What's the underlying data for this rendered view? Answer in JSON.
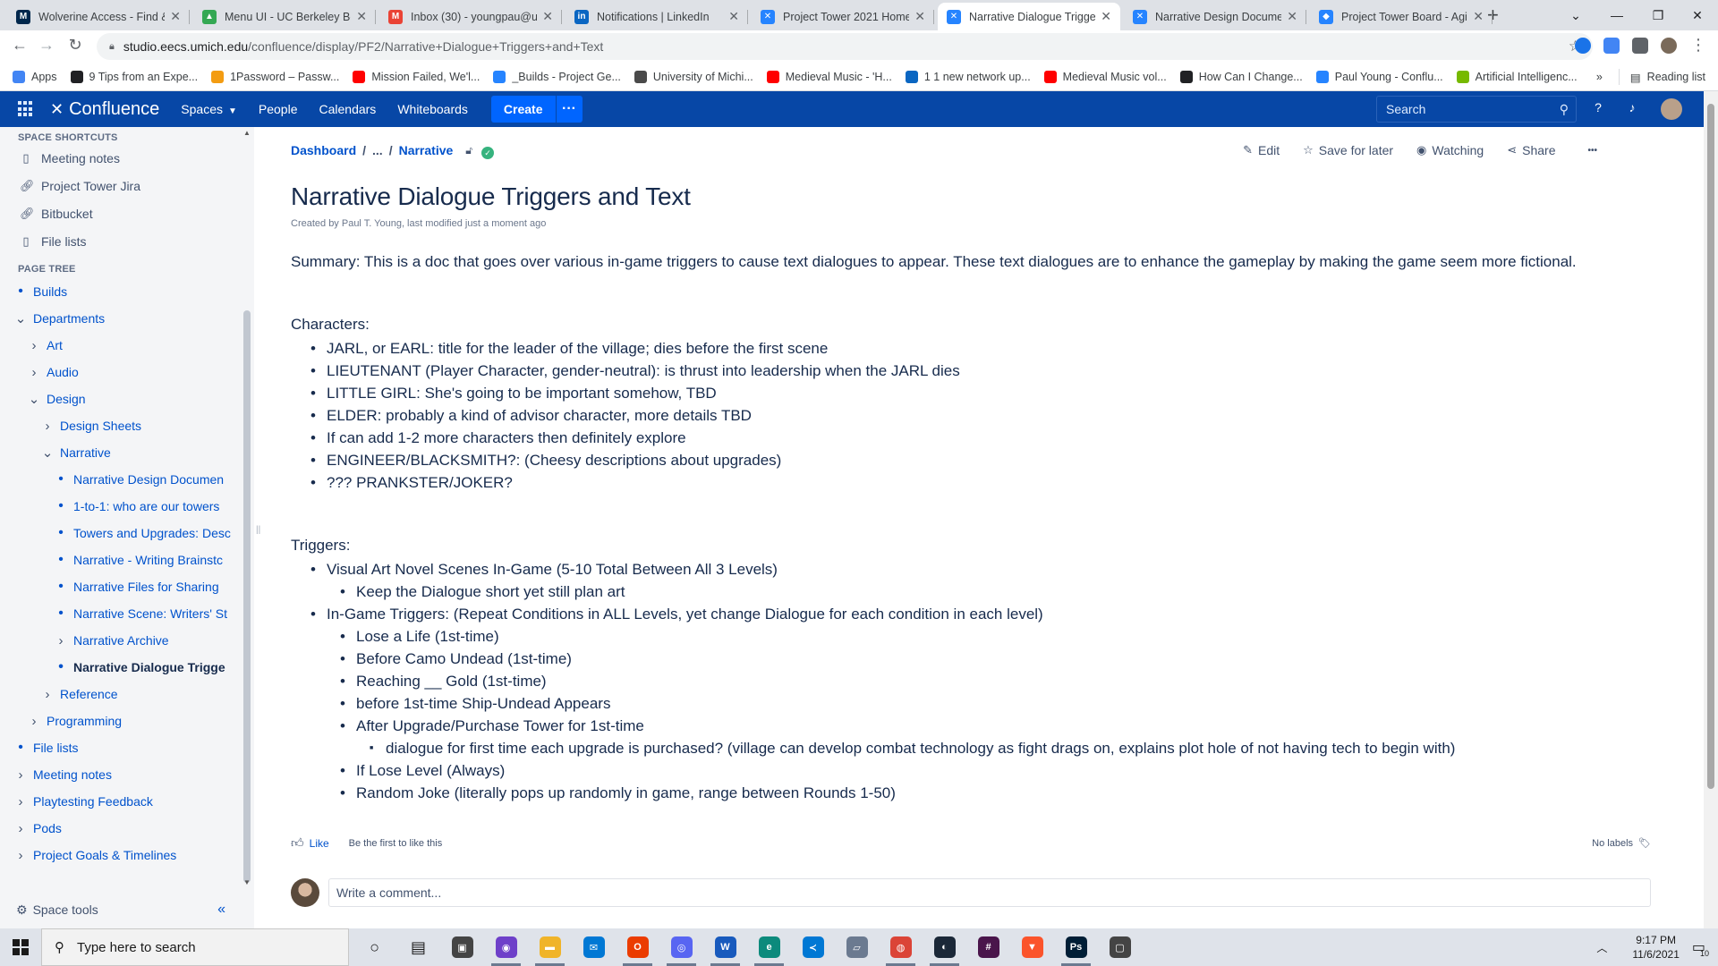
{
  "browser": {
    "tabs": [
      {
        "title": "Wolverine Access - Find & ",
        "icon": "M",
        "color": "#00274c",
        "active": false
      },
      {
        "title": "Menu UI - UC Berkeley Be",
        "icon": "▲",
        "color": "#34a853",
        "active": false
      },
      {
        "title": "Inbox (30) - youngpau@u",
        "icon": "M",
        "color": "#ea4335",
        "active": false
      },
      {
        "title": "Notifications | LinkedIn",
        "icon": "in",
        "color": "#0a66c2",
        "active": false
      },
      {
        "title": "Project Tower 2021 Home",
        "icon": "✕",
        "color": "#2684ff",
        "active": false
      },
      {
        "title": "Narrative Dialogue Trigge",
        "icon": "✕",
        "color": "#2684ff",
        "active": true
      },
      {
        "title": "Narrative Design Docume",
        "icon": "✕",
        "color": "#2684ff",
        "active": false
      },
      {
        "title": "Project Tower Board - Agil",
        "icon": "◆",
        "color": "#2684ff",
        "active": false
      }
    ],
    "url_host": "studio.eecs.umich.edu",
    "url_path": "/confluence/display/PF2/Narrative+Dialogue+Triggers+and+Text",
    "bookmarks": [
      {
        "label": "Apps",
        "color": "#4285f4"
      },
      {
        "label": "9 Tips from an Expe...",
        "color": "#202124"
      },
      {
        "label": "1Password – Passw...",
        "color": "#f39c12"
      },
      {
        "label": "Mission Failed, We'l...",
        "color": "#ff0000"
      },
      {
        "label": "_Builds - Project Ge...",
        "color": "#2684ff"
      },
      {
        "label": "University of Michi...",
        "color": "#4a4a4a"
      },
      {
        "label": "Medieval Music - 'H...",
        "color": "#ff0000"
      },
      {
        "label": "1 1 new network up...",
        "color": "#0a66c2"
      },
      {
        "label": "Medieval Music vol...",
        "color": "#ff0000"
      },
      {
        "label": "How Can I Change...",
        "color": "#202124"
      },
      {
        "label": "Paul Young - Conflu...",
        "color": "#2684ff"
      },
      {
        "label": "Artificial Intelligenc...",
        "color": "#76b900"
      }
    ],
    "reading_list": "Reading list"
  },
  "header": {
    "logo": "Confluence",
    "nav": [
      "Spaces",
      "People",
      "Calendars",
      "Whiteboards"
    ],
    "create": "Create",
    "more": "•••",
    "search_placeholder": "Search"
  },
  "sidebar": {
    "shortcuts_title": "SPACE SHORTCUTS",
    "shortcuts": [
      {
        "label": "Meeting notes",
        "icon": "document-icon"
      },
      {
        "label": "Project Tower Jira",
        "icon": "link-icon"
      },
      {
        "label": "Bitbucket",
        "icon": "link-icon"
      },
      {
        "label": "File lists",
        "icon": "document-icon"
      }
    ],
    "tree_title": "PAGE TREE",
    "tree": [
      {
        "label": "Builds",
        "level": 0,
        "marker": "dot"
      },
      {
        "label": "Departments",
        "level": 0,
        "marker": "open"
      },
      {
        "label": "Art",
        "level": 1,
        "marker": "closed"
      },
      {
        "label": "Audio",
        "level": 1,
        "marker": "closed"
      },
      {
        "label": "Design",
        "level": 1,
        "marker": "open"
      },
      {
        "label": "Design Sheets",
        "level": 2,
        "marker": "closed"
      },
      {
        "label": "Narrative",
        "level": 2,
        "marker": "open"
      },
      {
        "label": "Narrative Design Documen",
        "level": 3,
        "marker": "dot"
      },
      {
        "label": "1-to-1: who are our towers",
        "level": 3,
        "marker": "dot"
      },
      {
        "label": "Towers and Upgrades: Desc",
        "level": 3,
        "marker": "dot"
      },
      {
        "label": "Narrative - Writing Brainstc",
        "level": 3,
        "marker": "dot"
      },
      {
        "label": "Narrative Files for Sharing",
        "level": 3,
        "marker": "dot"
      },
      {
        "label": "Narrative Scene: Writers' St",
        "level": 3,
        "marker": "dot"
      },
      {
        "label": "Narrative Archive",
        "level": 3,
        "marker": "closed"
      },
      {
        "label": "Narrative Dialogue Trigge",
        "level": 3,
        "marker": "dot",
        "current": true
      },
      {
        "label": "Reference",
        "level": 2,
        "marker": "closed"
      },
      {
        "label": "Programming",
        "level": 1,
        "marker": "closed"
      },
      {
        "label": "File lists",
        "level": 0,
        "marker": "dot"
      },
      {
        "label": "Meeting notes",
        "level": 0,
        "marker": "closed"
      },
      {
        "label": "Playtesting Feedback",
        "level": 0,
        "marker": "closed"
      },
      {
        "label": "Pods",
        "level": 0,
        "marker": "closed"
      },
      {
        "label": "Project Goals & Timelines",
        "level": 0,
        "marker": "closed"
      }
    ],
    "space_tools": "Space tools"
  },
  "page": {
    "breadcrumb": [
      "Dashboard",
      "...",
      "Narrative"
    ],
    "actions": {
      "edit": "Edit",
      "save": "Save for later",
      "watch": "Watching",
      "share": "Share",
      "more": "•••"
    },
    "title": "Narrative Dialogue Triggers and Text",
    "byline": "Created by Paul T. Young, last modified just a moment ago",
    "summary": "Summary: This is a doc that goes over various in-game triggers to cause text dialogues to appear. These text dialogues are to enhance the gameplay by making the game seem more fictional.",
    "characters_heading": "Characters:",
    "characters": [
      "JARL, or EARL: title for the leader of the village; dies before the first scene",
      "LIEUTENANT (Player Character, gender-neutral): is thrust into leadership when the JARL dies",
      "LITTLE GIRL: She's going to be important somehow, TBD",
      "ELDER: probably a kind of advisor character, more details TBD",
      "If can add 1-2 more characters then definitely explore",
      "ENGINEER/BLACKSMITH?: (Cheesy descriptions about upgrades)",
      "??? PRANKSTER/JOKER?"
    ],
    "triggers_heading": "Triggers:",
    "trigger_1": "Visual Art Novel Scenes In-Game (5-10 Total Between All 3 Levels)",
    "trigger_1_sub": "Keep the Dialogue short yet still plan art",
    "trigger_2": "In-Game Triggers: (Repeat Conditions in ALL Levels, yet change Dialogue for each condition in each level)",
    "trigger_2_subs": [
      "Lose a Life (1st-time)",
      "Before Camo Undead (1st-time)",
      "Reaching __ Gold (1st-time)",
      "before 1st-time Ship-Undead Appears",
      "After Upgrade/Purchase Tower for 1st-time"
    ],
    "trigger_2_sub_detail": "dialogue for first time each upgrade is purchased? (village can develop combat technology as fight drags on, explains plot hole of not having tech to begin with)",
    "trigger_2_subs_after": [
      "If Lose Level (Always)",
      "Random Joke (literally pops up randomly in game, range between Rounds 1-50)"
    ],
    "like": "Like",
    "like_hint": "Be the first to like this",
    "labels": "No labels",
    "comment_placeholder": "Write a comment..."
  },
  "taskbar": {
    "search_placeholder": "Type here to search",
    "apps": [
      {
        "name": "cortana-icon",
        "color": "#1a1a1a",
        "glyph": "○"
      },
      {
        "name": "task-view-icon",
        "color": "#1a1a1a",
        "glyph": "▤"
      },
      {
        "name": "store-icon",
        "color": "#444444",
        "glyph": "▣"
      },
      {
        "name": "github-icon",
        "color": "#6e40c9",
        "glyph": "◉"
      },
      {
        "name": "file-explorer-icon",
        "color": "#f0b429",
        "glyph": "▬"
      },
      {
        "name": "mail-icon",
        "color": "#0078d4",
        "glyph": "✉"
      },
      {
        "name": "office-icon",
        "color": "#eb3c00",
        "glyph": "O"
      },
      {
        "name": "discord-icon",
        "color": "#5865f2",
        "glyph": "◎"
      },
      {
        "name": "word-icon",
        "color": "#185abd",
        "glyph": "W"
      },
      {
        "name": "edge-icon",
        "color": "#0c8a7c",
        "glyph": "e"
      },
      {
        "name": "vscode-icon",
        "color": "#0078d4",
        "glyph": "≺"
      },
      {
        "name": "unity-icon",
        "color": "#6b7a90",
        "glyph": "▱"
      },
      {
        "name": "chrome-icon",
        "color": "#db4437",
        "glyph": "◍"
      },
      {
        "name": "steam-icon",
        "color": "#1b2838",
        "glyph": "◐"
      },
      {
        "name": "slack-icon",
        "color": "#4a154b",
        "glyph": "#"
      },
      {
        "name": "brave-icon",
        "color": "#fb542b",
        "glyph": "▼"
      },
      {
        "name": "photoshop-icon",
        "color": "#001e36",
        "glyph": "Ps"
      },
      {
        "name": "twitch-icon",
        "color": "#444444",
        "glyph": "▢"
      }
    ],
    "time": "9:17 PM",
    "date": "11/6/2021",
    "notif_count": "10"
  }
}
